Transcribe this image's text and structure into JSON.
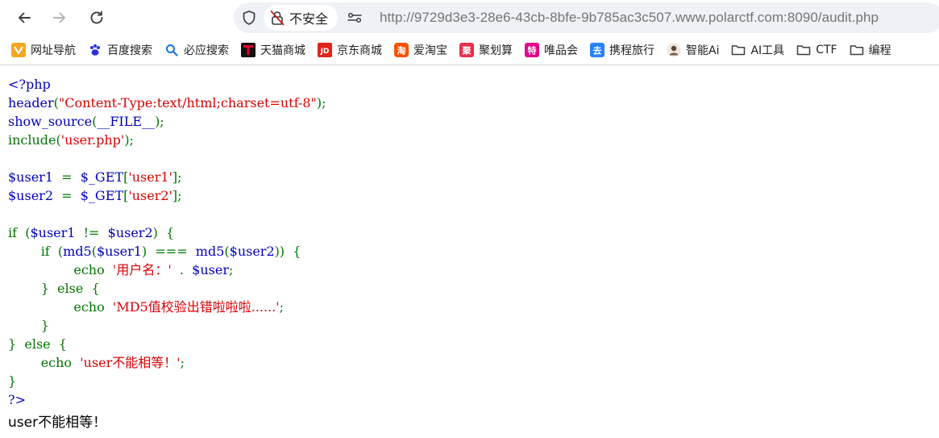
{
  "colors": {
    "php_default": "#0000BB",
    "php_keyword": "#007700",
    "php_string": "#DD0000"
  },
  "toolbar": {
    "back_icon": "arrow-left-icon",
    "forward_icon": "arrow-right-icon",
    "reload_icon": "reload-icon",
    "security_label": "不安全",
    "url_scheme": "http://",
    "url_host": "9729d3e3-28e6-43cb-8bfe-9b785ac3c507.www.polarctf.com",
    "url_rest": ":8090/audit.php"
  },
  "bookmarks": [
    {
      "label": "网址导航",
      "icon": "hao-navigation-icon"
    },
    {
      "label": "百度搜索",
      "icon": "baidu-paw-icon"
    },
    {
      "label": "必应搜索",
      "icon": "search-icon"
    },
    {
      "label": "天猫商城",
      "icon": "tmall-icon"
    },
    {
      "label": "京东商城",
      "icon": "jd-icon"
    },
    {
      "label": "爱淘宝",
      "icon": "taobao-icon"
    },
    {
      "label": "聚划算",
      "icon": "juhuasuan-icon"
    },
    {
      "label": "唯品会",
      "icon": "vipshop-icon"
    },
    {
      "label": "携程旅行",
      "icon": "ctrip-icon"
    },
    {
      "label": "智能Ai",
      "icon": "avatar-icon"
    },
    {
      "label": "AI工具",
      "icon": "folder-icon"
    },
    {
      "label": "CTF",
      "icon": "folder-icon"
    },
    {
      "label": "编程",
      "icon": "folder-icon"
    }
  ],
  "source_lines": [
    [
      {
        "t": "<?php",
        "c": "default"
      }
    ],
    [
      {
        "t": "header",
        "c": "default"
      },
      {
        "t": "(",
        "c": "keyword"
      },
      {
        "t": "\"Content-Type:text/html;charset=utf-8\"",
        "c": "string"
      },
      {
        "t": ");",
        "c": "keyword"
      }
    ],
    [
      {
        "t": "show_source",
        "c": "default"
      },
      {
        "t": "(",
        "c": "keyword"
      },
      {
        "t": "__FILE__",
        "c": "default"
      },
      {
        "t": ");",
        "c": "keyword"
      }
    ],
    [
      {
        "t": "include(",
        "c": "keyword"
      },
      {
        "t": "'user.php'",
        "c": "string"
      },
      {
        "t": ");",
        "c": "keyword"
      }
    ],
    [],
    [
      {
        "t": "$user1  ",
        "c": "default"
      },
      {
        "t": "=  ",
        "c": "keyword"
      },
      {
        "t": "$_GET",
        "c": "default"
      },
      {
        "t": "[",
        "c": "keyword"
      },
      {
        "t": "'user1'",
        "c": "string"
      },
      {
        "t": "];",
        "c": "keyword"
      }
    ],
    [
      {
        "t": "$user2  ",
        "c": "default"
      },
      {
        "t": "=  ",
        "c": "keyword"
      },
      {
        "t": "$_GET",
        "c": "default"
      },
      {
        "t": "[",
        "c": "keyword"
      },
      {
        "t": "'user2'",
        "c": "string"
      },
      {
        "t": "];",
        "c": "keyword"
      }
    ],
    [],
    [
      {
        "t": "if  (",
        "c": "keyword"
      },
      {
        "t": "$user1  ",
        "c": "default"
      },
      {
        "t": "!=  ",
        "c": "keyword"
      },
      {
        "t": "$user2",
        "c": "default"
      },
      {
        "t": ")  {",
        "c": "keyword"
      }
    ],
    [
      {
        "t": "        if  (",
        "c": "keyword"
      },
      {
        "t": "md5",
        "c": "default"
      },
      {
        "t": "(",
        "c": "keyword"
      },
      {
        "t": "$user1",
        "c": "default"
      },
      {
        "t": ")  ===  ",
        "c": "keyword"
      },
      {
        "t": "md5",
        "c": "default"
      },
      {
        "t": "(",
        "c": "keyword"
      },
      {
        "t": "$user2",
        "c": "default"
      },
      {
        "t": "))  {",
        "c": "keyword"
      }
    ],
    [
      {
        "t": "                echo  ",
        "c": "keyword"
      },
      {
        "t": "'用户名：'  ",
        "c": "string"
      },
      {
        "t": ".  ",
        "c": "keyword"
      },
      {
        "t": "$user",
        "c": "default"
      },
      {
        "t": ";",
        "c": "keyword"
      }
    ],
    [
      {
        "t": "        }  else  {",
        "c": "keyword"
      }
    ],
    [
      {
        "t": "                echo  ",
        "c": "keyword"
      },
      {
        "t": "'MD5值校验出错啦啦啦......'",
        "c": "string"
      },
      {
        "t": ";",
        "c": "keyword"
      }
    ],
    [
      {
        "t": "        }",
        "c": "keyword"
      }
    ],
    [
      {
        "t": "}  else  {",
        "c": "keyword"
      }
    ],
    [
      {
        "t": "        echo  ",
        "c": "keyword"
      },
      {
        "t": "'user不能相等！'",
        "c": "string"
      },
      {
        "t": ";",
        "c": "keyword"
      }
    ],
    [
      {
        "t": "}",
        "c": "keyword"
      }
    ],
    [
      {
        "t": "?>",
        "c": "default"
      }
    ]
  ],
  "output_text": "user不能相等！"
}
